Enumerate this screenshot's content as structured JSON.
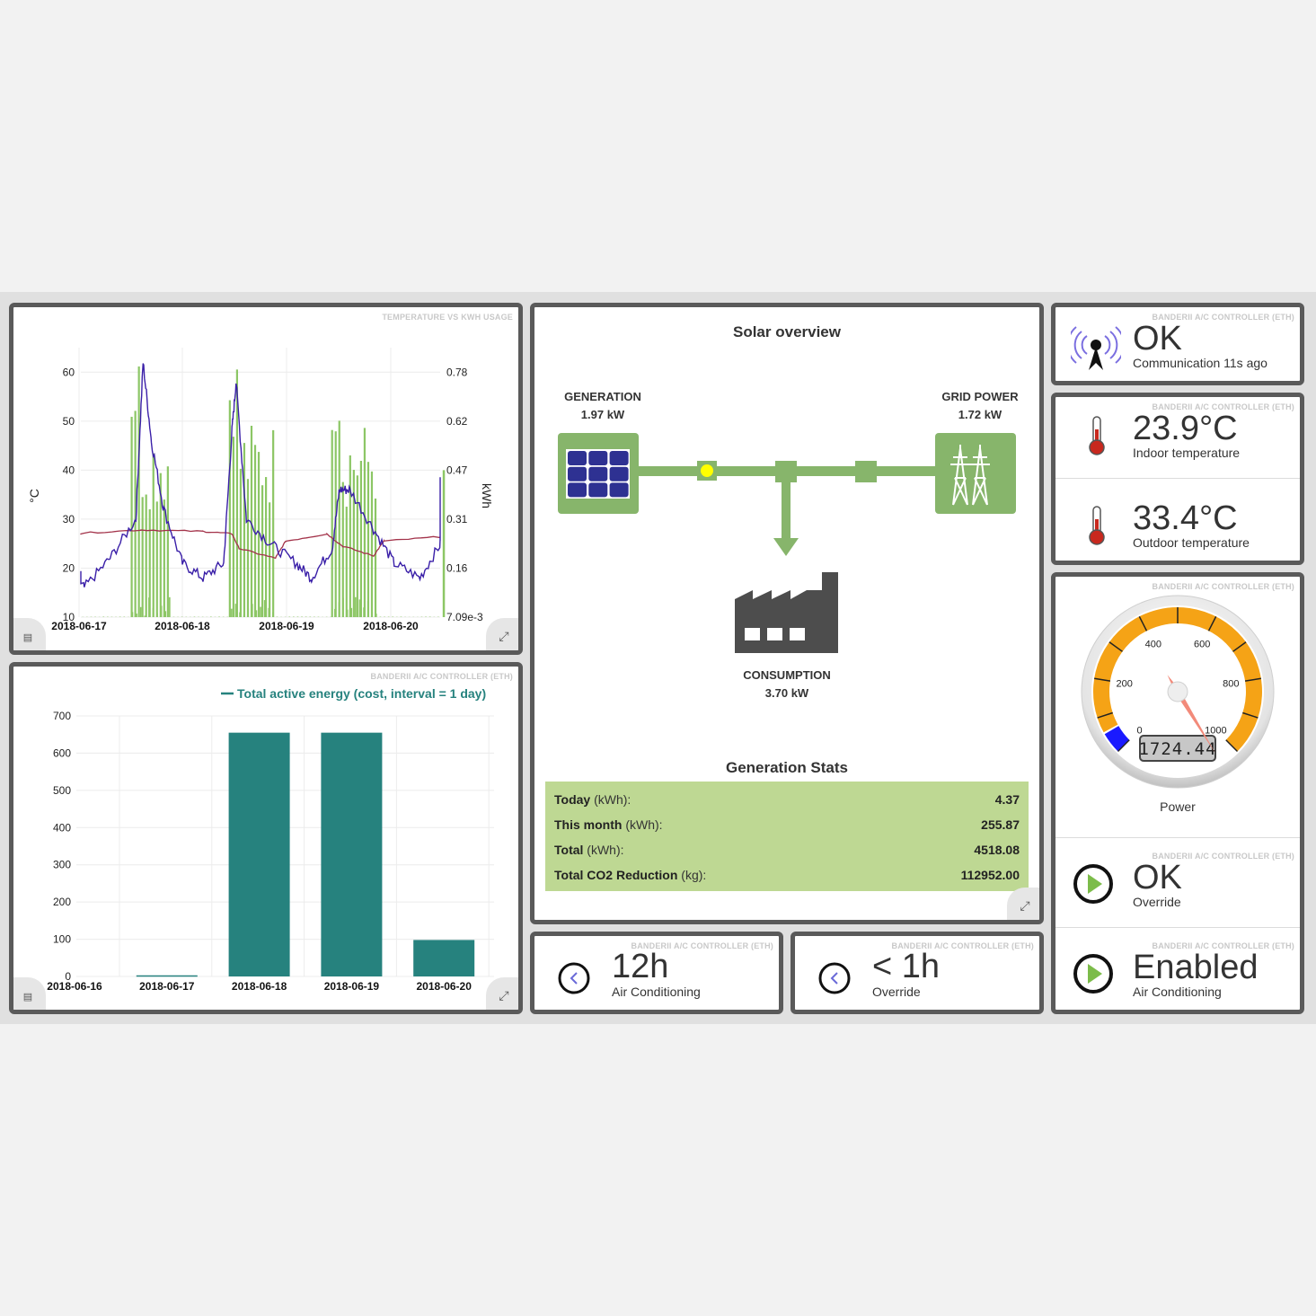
{
  "temp_chart": {
    "tag": "TEMPERATURE VS KWH USAGE",
    "y_left_label": "°C",
    "y_right_label": "kWh",
    "y_left_ticks": [
      "60",
      "50",
      "40",
      "30",
      "20",
      "10"
    ],
    "y_right_ticks": [
      "0.78",
      "0.62",
      "0.47",
      "0.31",
      "0.16",
      "7.09e-3"
    ],
    "x_ticks": [
      "2018-06-17",
      "2018-06-18",
      "2018-06-19",
      "2018-06-20"
    ],
    "colors": {
      "indoor": "#3a1fa8",
      "outdoor": "#a3334a",
      "bars": "#8cc665"
    }
  },
  "energy_chart": {
    "tag": "BANDERII A/C CONTROLLER (ETH)",
    "legend": "Total active energy (cost, interval = 1 day)",
    "bar_color": "#26827e"
  },
  "chart_data": [
    {
      "type": "line",
      "x": [
        "2018-06-17",
        "2018-06-18",
        "2018-06-19",
        "2018-06-20"
      ],
      "ylim": [
        10,
        65
      ],
      "y2lim": [
        0.00709,
        0.78
      ],
      "series": [
        {
          "values": [
            18,
            62,
            20,
            65,
            20,
            46,
            20,
            40
          ]
        },
        {
          "values": [
            27,
            28,
            27,
            22,
            26,
            24,
            26,
            26
          ]
        }
      ]
    },
    {
      "type": "bar",
      "categories": [
        "2018-06-16",
        "2018-06-17",
        "2018-06-18",
        "2018-06-19",
        "2018-06-20"
      ],
      "series": [
        {
          "name": "Total active energy (cost, interval = 1 day)",
          "values": [
            0,
            3,
            655,
            655,
            98
          ]
        }
      ],
      "ylim": [
        0,
        700
      ],
      "yticks": [
        "700",
        "600",
        "500",
        "400",
        "300",
        "200",
        "100",
        "0"
      ]
    }
  ],
  "solar": {
    "title": "Solar overview",
    "generation_label": "GENERATION",
    "generation_value": "1.97 kW",
    "grid_label": "GRID POWER",
    "grid_value": "1.72 kW",
    "consumption_label": "CONSUMPTION",
    "consumption_value": "3.70 kW",
    "stats_title": "Generation Stats",
    "stats": [
      {
        "bold": "Today",
        "rest": " (kWh):",
        "value": "4.37"
      },
      {
        "bold": "This month",
        "rest": " (kWh):",
        "value": "255.87"
      },
      {
        "bold": "Total",
        "rest": " (kWh):",
        "value": "4518.08"
      },
      {
        "bold": "Total CO2 Reduction",
        "rest": " (kg):",
        "value": "112952.00"
      }
    ],
    "colors": {
      "green": "#87b56b",
      "panel_blue": "#2e3192",
      "factory": "#4d4d4d",
      "stats_bg": "#bed893"
    }
  },
  "comm": {
    "tag": "BANDERII A/C CONTROLLER (ETH)",
    "value": "OK",
    "label": "Communication 11s ago"
  },
  "temps": {
    "tag": "BANDERII A/C CONTROLLER (ETH)",
    "indoor_value": "23.9°C",
    "indoor_label": "Indoor temperature",
    "outdoor_value": "33.4°C",
    "outdoor_label": "Outdoor temperature"
  },
  "gauge": {
    "tag": "BANDERII A/C CONTROLLER (ETH)",
    "ticks": [
      "0",
      "200",
      "400",
      "600",
      "800",
      "1000"
    ],
    "display": "1724.44",
    "label": "Power",
    "colors": {
      "arc": "#f5a316",
      "needle": "#f28a7a"
    }
  },
  "override_status": {
    "tag": "BANDERII A/C CONTROLLER (ETH)",
    "value": "OK",
    "label": "Override"
  },
  "ac_status": {
    "tag": "BANDERII A/C CONTROLLER (ETH)",
    "value": "Enabled",
    "label": "Air Conditioning"
  },
  "timer_ac": {
    "tag": "BANDERII A/C CONTROLLER (ETH)",
    "value": "12h",
    "label": "Air Conditioning"
  },
  "timer_override": {
    "tag": "BANDERII A/C CONTROLLER (ETH)",
    "value": "< 1h",
    "label": "Override"
  }
}
